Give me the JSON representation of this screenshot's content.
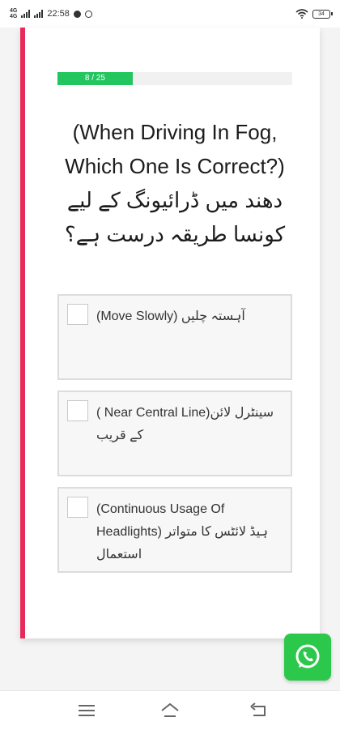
{
  "status_bar": {
    "network_top": "4G",
    "network_bottom": "4G",
    "time": "22:58",
    "battery": "34",
    "icons": [
      "signal-icon",
      "notification-dot-icon",
      "whatsapp-status-icon",
      "wifi-icon",
      "battery-icon"
    ]
  },
  "quiz": {
    "progress_label": "8 / 25",
    "progress_fraction": 0.32,
    "question_en": "(When Driving In Fog, Which One Is Correct?)",
    "question_ur": "دھند میں ڈرائیونگ کے لیے کونسا طریقہ درست ہے؟",
    "options": [
      {
        "text": "(Move Slowly) آہستہ چلیں"
      },
      {
        "text": "( Near Central Line)سینٹرل لائن کے قریب"
      },
      {
        "text": "(Continuous Usage Of Headlights) ہیڈ لائٹس کا متواتر استعمال"
      }
    ]
  },
  "colors": {
    "accent_stripe": "#e8295b",
    "progress": "#22c55e",
    "whatsapp": "#2cc84c"
  },
  "fab": {
    "icon": "whatsapp-icon"
  },
  "nav": {
    "icons": [
      "menu-icon",
      "home-icon",
      "back-icon"
    ]
  }
}
